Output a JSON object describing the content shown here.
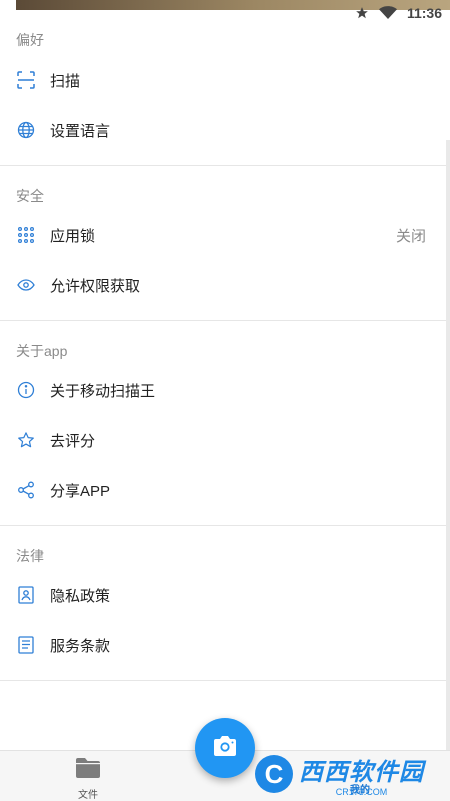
{
  "status_bar": {
    "time": "11:36"
  },
  "sections": {
    "preferences": {
      "header": "偏好",
      "items": [
        {
          "label": "扫描",
          "icon": "scan-icon"
        },
        {
          "label": "设置语言",
          "icon": "globe-icon"
        }
      ]
    },
    "security": {
      "header": "安全",
      "items": [
        {
          "label": "应用锁",
          "value": "关闭",
          "icon": "keypad-icon"
        },
        {
          "label": "允许权限获取",
          "icon": "eye-icon"
        }
      ]
    },
    "about": {
      "header": "关于app",
      "items": [
        {
          "label": "关于移动扫描王",
          "icon": "info-icon"
        },
        {
          "label": "去评分",
          "icon": "star-icon"
        },
        {
          "label": "分享APP",
          "icon": "share-icon"
        }
      ]
    },
    "legal": {
      "header": "法律",
      "items": [
        {
          "label": "隐私政策",
          "icon": "privacy-icon"
        },
        {
          "label": "服务条款",
          "icon": "document-icon"
        }
      ]
    }
  },
  "bottom_nav": {
    "files_label": "文件",
    "mine_label": "我的"
  },
  "watermark": {
    "text": "西西软件园",
    "sub": "CR173.COM"
  },
  "colors": {
    "accent": "#2196f3",
    "icon_blue": "#2f7fd6",
    "divider": "#e6e6e6"
  }
}
